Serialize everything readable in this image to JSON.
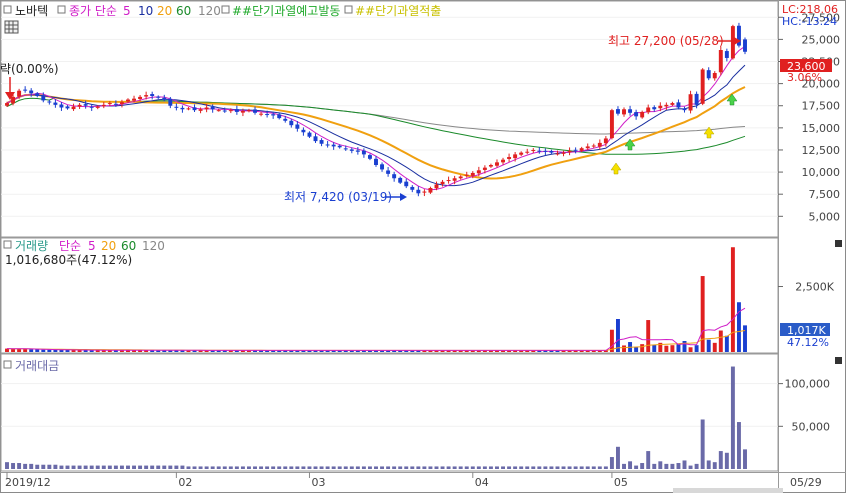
{
  "price_panel": {
    "legend": {
      "name": "노바텍",
      "close_ma": "종가 단순",
      "periods": [
        "5",
        "10",
        "20",
        "60",
        "120"
      ],
      "signal1": "##단기과열예고발동",
      "signal2": "##단기과열적출"
    },
    "left_cut_label": "략(0.00%)",
    "lc_label": "LC:218.06",
    "hc_label": "HC:-13.24",
    "current_price": "23,600",
    "change_pct": "3.06%",
    "high_label": "최고 27,200 (05/28)",
    "low_label": "최저 7,420 (03/19)"
  },
  "volume_panel": {
    "legend": {
      "name": "거래량",
      "ma": "단순",
      "periods": [
        "5",
        "20",
        "60",
        "120"
      ]
    },
    "current": "1,016,680주(47.12%)",
    "last_value_label": "1,017K",
    "last_pct_label": "47.12%"
  },
  "amount_panel": {
    "legend": {
      "name": "거래대금"
    }
  },
  "x_axis": {
    "labels": [
      "2019/12",
      "02",
      "03",
      "04",
      "05",
      "05/29"
    ]
  },
  "colors": {
    "up": "#e02020",
    "down": "#1a3fd0",
    "ma5": "#d01ec8",
    "ma10": "#1a2fa0",
    "ma20": "#f0a010",
    "ma60": "#1a8a2a",
    "ma120": "#888888",
    "amount": "#6a6aa8"
  },
  "chart_data": [
    {
      "type": "candlestick",
      "title": "노바텍",
      "y_ticks": [
        "27,500",
        "25,000",
        "22,500",
        "20,000",
        "17,500",
        "15,000",
        "12,500",
        "10,000",
        "7,500",
        "5,000"
      ],
      "ylim": [
        3000,
        29000
      ],
      "closes": [
        17800,
        18500,
        19200,
        19300,
        18900,
        18600,
        18100,
        17900,
        17600,
        17300,
        17200,
        17400,
        17600,
        17500,
        17300,
        17400,
        17600,
        17800,
        17700,
        17900,
        18200,
        18300,
        18500,
        18700,
        18600,
        18400,
        18200,
        17500,
        17300,
        17100,
        17200,
        17000,
        17100,
        17300,
        17100,
        17000,
        16900,
        17000,
        16800,
        16900,
        17000,
        16700,
        16600,
        16500,
        16400,
        16100,
        15800,
        15300,
        14900,
        14500,
        14000,
        13500,
        13200,
        13100,
        12900,
        12800,
        12600,
        12400,
        12300,
        12000,
        11500,
        10800,
        10300,
        9800,
        9300,
        8800,
        8400,
        8000,
        7600,
        7800,
        8200,
        8600,
        8900,
        9100,
        9300,
        9500,
        9700,
        9900,
        10200,
        10500,
        10800,
        11100,
        11400,
        11700,
        12000,
        12200,
        12300,
        12500,
        12400,
        12300,
        12200,
        12100,
        12200,
        12400,
        12500,
        12700,
        12900,
        13000,
        13300,
        13800,
        17000,
        16600,
        17100,
        16700,
        16300,
        16800,
        17300,
        17100,
        17500,
        17600,
        17800,
        17300,
        17000,
        18800,
        17600,
        21600,
        20600,
        21200,
        23800,
        22900,
        26500,
        24300,
        23600
      ],
      "high": {
        "value": 27200,
        "date": "05/28"
      },
      "low": {
        "value": 7420,
        "date": "03/19"
      },
      "ma_periods": [
        5,
        10,
        20,
        60,
        120
      ]
    },
    {
      "type": "bar",
      "title": "거래량",
      "y_ticks": [
        "2,500K"
      ],
      "ylim": [
        0,
        4200
      ],
      "unit": "K",
      "values": [
        130,
        120,
        120,
        120,
        100,
        100,
        90,
        90,
        80,
        80,
        80,
        80,
        70,
        70,
        70,
        70,
        70,
        70,
        70,
        70,
        70,
        70,
        70,
        70,
        70,
        70,
        70,
        70,
        70,
        70,
        60,
        60,
        60,
        60,
        60,
        60,
        60,
        60,
        60,
        60,
        60,
        60,
        60,
        60,
        60,
        60,
        60,
        60,
        60,
        60,
        60,
        60,
        60,
        60,
        60,
        60,
        60,
        60,
        60,
        60,
        60,
        60,
        60,
        60,
        60,
        60,
        60,
        60,
        60,
        60,
        60,
        60,
        60,
        60,
        60,
        60,
        60,
        60,
        60,
        60,
        60,
        60,
        60,
        60,
        60,
        60,
        60,
        60,
        60,
        60,
        60,
        60,
        60,
        60,
        60,
        60,
        60,
        60,
        60,
        60,
        850,
        1260,
        250,
        380,
        180,
        300,
        1220,
        270,
        350,
        240,
        260,
        300,
        420,
        180,
        260,
        2900,
        470,
        350,
        820,
        620,
        4000,
        1900,
        1017
      ]
    },
    {
      "type": "bar",
      "title": "거래대금",
      "y_ticks": [
        "100,000",
        "50,000"
      ],
      "ylim": [
        0,
        130000
      ],
      "values": [
        8000,
        7000,
        7000,
        6000,
        6000,
        5000,
        5000,
        5000,
        5000,
        4000,
        4000,
        4000,
        4000,
        4000,
        4000,
        4000,
        4000,
        4000,
        4000,
        4000,
        4000,
        4000,
        4000,
        4000,
        4000,
        4000,
        4000,
        4000,
        4000,
        4000,
        3000,
        3000,
        3000,
        3000,
        3000,
        3000,
        3000,
        3000,
        3000,
        3000,
        3000,
        3000,
        3000,
        3000,
        3000,
        3000,
        3000,
        3000,
        3000,
        3000,
        3000,
        3000,
        3000,
        3000,
        3000,
        3000,
        3000,
        3000,
        3000,
        3000,
        3000,
        3000,
        3000,
        3000,
        3000,
        3000,
        3000,
        3000,
        3000,
        3000,
        3000,
        3000,
        3000,
        3000,
        3000,
        3000,
        3000,
        3000,
        3000,
        3000,
        3000,
        3000,
        3000,
        3000,
        3000,
        3000,
        3000,
        3000,
        3000,
        3000,
        3000,
        3000,
        3000,
        3000,
        3000,
        3000,
        3000,
        3000,
        3000,
        3000,
        14000,
        26000,
        6000,
        9000,
        4000,
        7000,
        21000,
        6000,
        9000,
        6000,
        6000,
        7000,
        10000,
        4000,
        6000,
        58000,
        10000,
        8000,
        21000,
        19000,
        120000,
        55000,
        23000
      ]
    }
  ]
}
